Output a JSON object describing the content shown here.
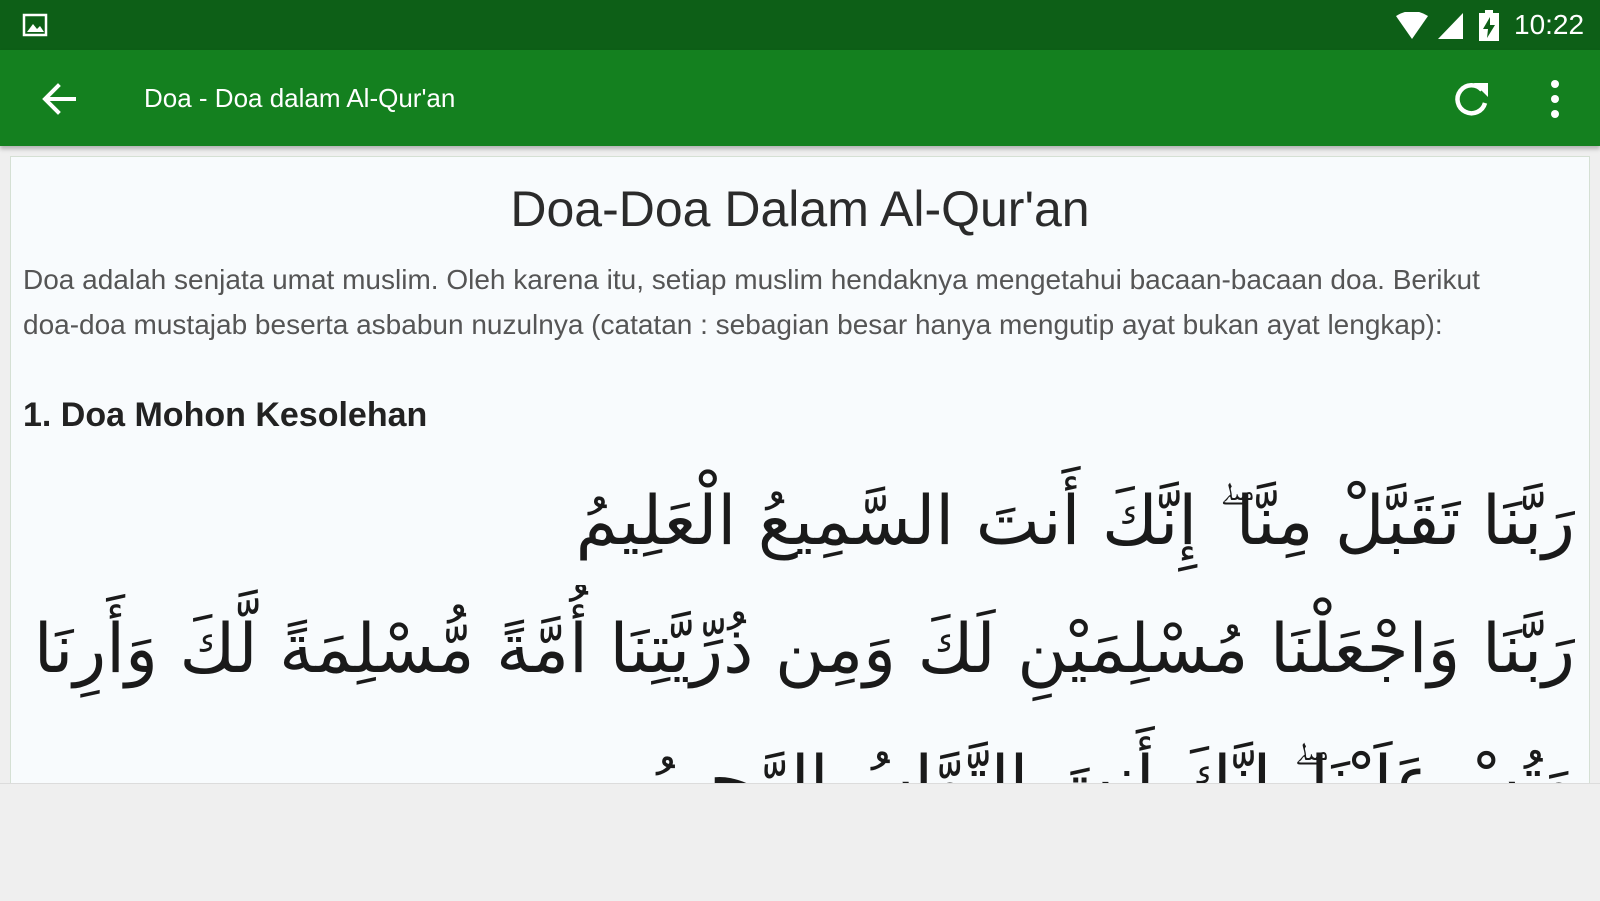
{
  "status_bar": {
    "time": "10:22",
    "icons": [
      "gallery-icon",
      "wifi-icon",
      "signal-icon",
      "battery-charging-icon"
    ]
  },
  "app_bar": {
    "title": "Doa - Doa dalam Al-Qur'an",
    "back_icon": "arrow-back-icon",
    "refresh_icon": "refresh-icon",
    "more_icon": "more-vert-icon",
    "color": "#14801f",
    "status_color": "#0d5f17"
  },
  "content": {
    "title": "Doa-Doa Dalam Al-Qur'an",
    "intro": "Doa adalah senjata umat muslim. Oleh karena itu, setiap muslim hendaknya mengetahui bacaan-bacaan doa. Berikut doa-doa mustajab beserta asbabun nuzulnya (catatan : sebagian besar hanya mengutip ayat bukan ayat lengkap):",
    "intro_line_1": "Doa adalah senjata umat muslim. Oleh karena itu, setiap muslim hendaknya mengetahui bacaan-bacaan doa. Berikut",
    "intro_line_2": "doa-doa mustajab beserta asbabun nuzulnya (catatan : sebagian besar hanya mengutip ayat bukan ayat lengkap):",
    "sections": [
      {
        "heading": "1. Doa Mohon Kesolehan",
        "arabic_lines": [
          "رَبَّنَا تَقَبَّلْ مِنَّا ۖ إِنَّكَ أَنتَ السَّمِيعُ الْعَلِيمُ",
          "رَبَّنَا وَاجْعَلْنَا مُسْلِمَيْنِ لَكَ وَمِن ذُرِّيَّتِنَا أُمَّةً مُّسْلِمَةً لَّكَ وَأَرِنَا مَنَاسِكَنَا",
          "وَتُبْ عَلَيْنَا ۖ إِنَّكَ أَنتَ التَّوَّابُ الرَّحِيمُ"
        ]
      }
    ]
  }
}
